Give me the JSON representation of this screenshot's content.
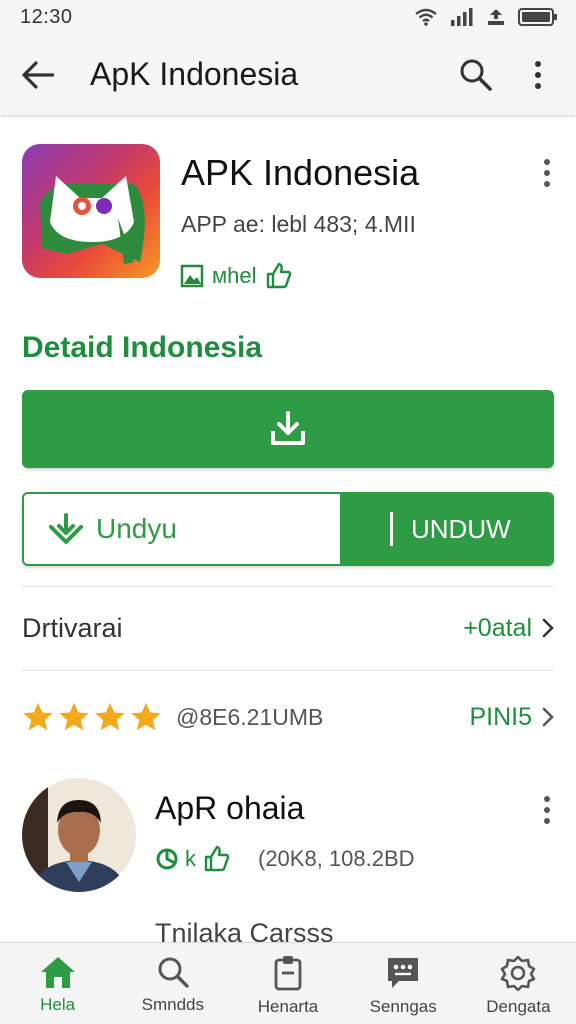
{
  "status_bar": {
    "time": "12:30"
  },
  "app_bar": {
    "title": "ApK Indonesia"
  },
  "app": {
    "name": "APK Indonesia",
    "meta": "APP ae: lebl 483; 4.MII",
    "badge_label": "мhel"
  },
  "section_title": "Detaid Indonesia",
  "split_button": {
    "left_label": "Undyu",
    "right_label": "UNDUW"
  },
  "details_row": {
    "label": "Drtivarai",
    "link": "+0atal"
  },
  "rating_row": {
    "stars": 4,
    "count": "@8E6.21UMB",
    "link": "PINI5"
  },
  "review": {
    "name": "ApR ohaia",
    "likes": "k",
    "date": "(20K8, 108.2BD",
    "text": "Tnilaka Carsss"
  },
  "colors": {
    "accent": "#2e9b45",
    "accent_text": "#1e8e3e",
    "star": "#f4a91d"
  },
  "bottom_nav": [
    {
      "label": "Hela",
      "icon": "home-icon",
      "active": true
    },
    {
      "label": "Smndds",
      "icon": "search-icon",
      "active": false
    },
    {
      "label": "Henarta",
      "icon": "clipboard-icon",
      "active": false
    },
    {
      "label": "Senngas",
      "icon": "chat-icon",
      "active": false
    },
    {
      "label": "Dengata",
      "icon": "settings-icon",
      "active": false
    }
  ]
}
